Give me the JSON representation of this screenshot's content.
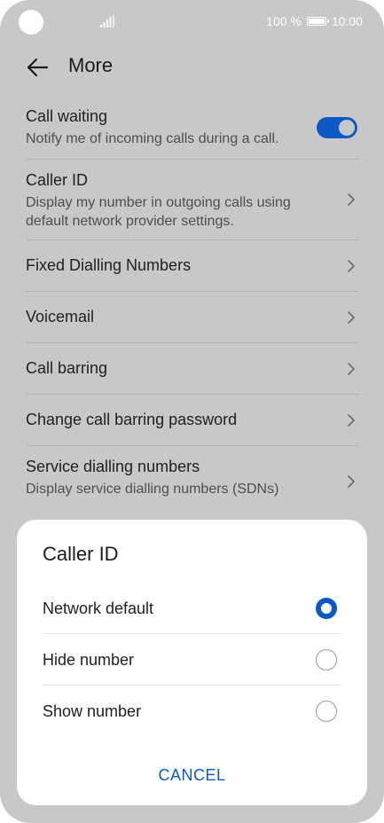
{
  "status_bar": {
    "battery": "100 %",
    "time": "10:00"
  },
  "header": {
    "title": "More"
  },
  "settings": {
    "call_waiting": {
      "title": "Call waiting",
      "subtitle": "Notify me of incoming calls during a call.",
      "enabled": true
    },
    "caller_id": {
      "title": "Caller ID",
      "subtitle": "Display my number in outgoing calls using default network provider settings."
    },
    "fixed_dialling": {
      "title": "Fixed Dialling Numbers"
    },
    "voicemail": {
      "title": "Voicemail"
    },
    "call_barring": {
      "title": "Call barring"
    },
    "change_password": {
      "title": "Change call barring password"
    },
    "service_dialling": {
      "title": "Service dialling numbers",
      "subtitle": "Display service dialling numbers (SDNs)"
    }
  },
  "dialog": {
    "title": "Caller ID",
    "options": [
      {
        "label": "Network default",
        "selected": true
      },
      {
        "label": "Hide number",
        "selected": false
      },
      {
        "label": "Show number",
        "selected": false
      }
    ],
    "cancel_label": "CANCEL"
  },
  "colors": {
    "accent": "#0a59c5",
    "overlay_background": "#c8c8c8",
    "dialog_background": "#ffffff"
  }
}
